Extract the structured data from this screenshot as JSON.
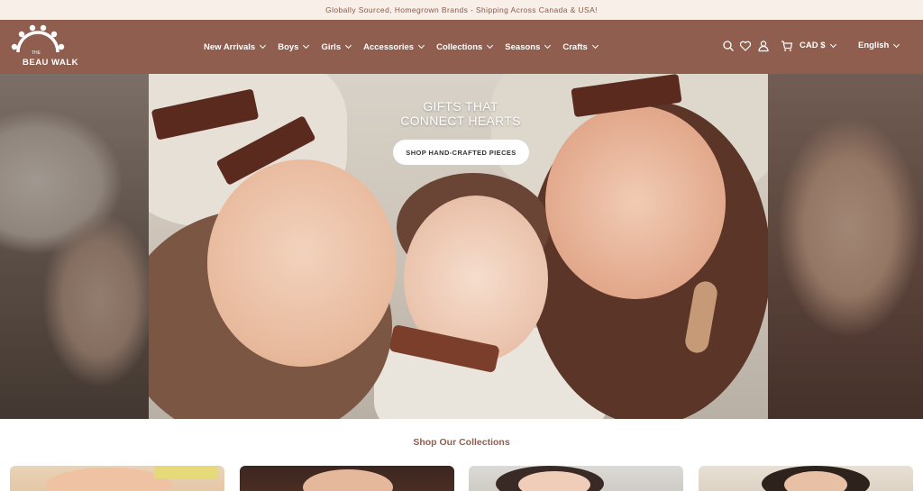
{
  "announcement": "Globally Sourced, Homegrown Brands - Shipping Across Canada & USA!",
  "logo": {
    "small": "THE",
    "text": "BEAU WALK"
  },
  "nav": [
    {
      "label": "New Arrivals"
    },
    {
      "label": "Boys"
    },
    {
      "label": "Girls"
    },
    {
      "label": "Accessories"
    },
    {
      "label": "Collections"
    },
    {
      "label": "Seasons"
    },
    {
      "label": "Crafts"
    }
  ],
  "tools": {
    "currency": "CAD $",
    "language": "English",
    "icons": [
      "search-icon",
      "heart-icon",
      "account-icon",
      "cart-icon"
    ]
  },
  "hero": {
    "title_line1": "GIFTS THAT",
    "title_line2": "CONNECT HEARTS",
    "cta": "SHOP HAND-CRAFTED PIECES"
  },
  "collections": {
    "title": "Shop Our Collections"
  },
  "colors": {
    "brand": "#8f5e4f",
    "announcement_bg": "#f7efe8",
    "announcement_text": "#8a5a4a"
  }
}
